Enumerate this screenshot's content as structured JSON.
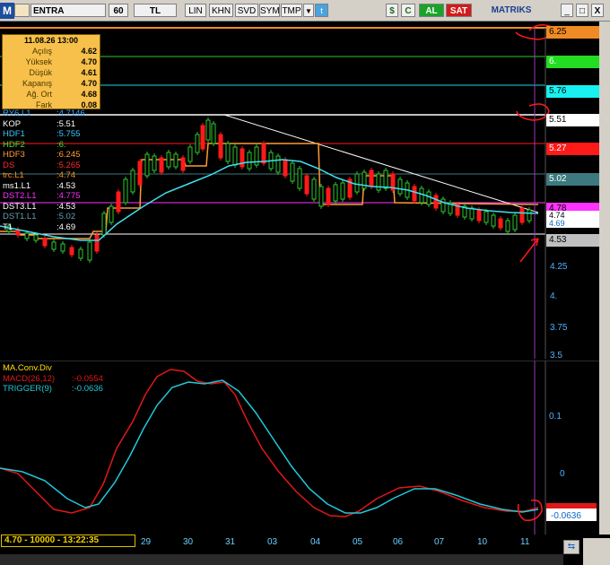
{
  "toolbar": {
    "logo": "M",
    "symbol": "ENTRA",
    "period": "60",
    "currency": "TL",
    "buttons": [
      "LIN",
      "KHN",
      "SVD",
      "SYM",
      "TMP"
    ],
    "dropdown_icon": "▼",
    "twitter_icon": "t",
    "dollar_icon": "$",
    "refresh_icon": "C",
    "buy": "AL",
    "sell": "SAT",
    "brand": "MATRIKS",
    "minimize": "_",
    "maximize": "□",
    "close": "X"
  },
  "info_box": {
    "date": "11.08.26 13:00",
    "rows": [
      {
        "label": "Açılış",
        "value": "4.62"
      },
      {
        "label": "Yüksek",
        "value": "4.70"
      },
      {
        "label": "Düşük",
        "value": "4.61"
      },
      {
        "label": "Kapanış",
        "value": "4.70"
      },
      {
        "label": "Ağ. Ort",
        "value": "4.68"
      },
      {
        "label": "Fark",
        "value": "0.08"
      }
    ]
  },
  "indicators": [
    {
      "name": "RY6.L1",
      "value": ":4.7146",
      "color": "#38a8ff"
    },
    {
      "name": "KOP",
      "value": ":5.51",
      "color": "#ffffff"
    },
    {
      "name": "HDF1",
      "value": ":5.755",
      "color": "#3bc8ff"
    },
    {
      "name": "HDF2",
      "value": ":6.",
      "color": "#39e639"
    },
    {
      "name": "HDF3",
      "value": ":6.245",
      "color": "#ff9b33"
    },
    {
      "name": "DS",
      "value": ":5.265",
      "color": "#ff2a2a"
    },
    {
      "name": "trc.L1",
      "value": ":4.74",
      "color": "#ff8a1a"
    },
    {
      "name": "ms1.L1",
      "value": ":4.53",
      "color": "#ffffff"
    },
    {
      "name": "DST2.L1",
      "value": ":4.775",
      "color": "#ff30ff"
    },
    {
      "name": "DST3.L1",
      "value": ":4.53",
      "color": "#ffffff"
    },
    {
      "name": "DST1.L1",
      "value": ":5.02",
      "color": "#5fa0b5"
    },
    {
      "name": "T1",
      "value": ":4.69",
      "color": "#ffffff"
    }
  ],
  "price_tags": [
    {
      "text": "6.25",
      "bg": "#f08a24",
      "fg": "#000000"
    },
    {
      "text": "6.",
      "bg": "#22dd22",
      "fg": "#ffffff"
    },
    {
      "text": "5.76",
      "bg": "#19f0f0",
      "fg": "#000000"
    },
    {
      "text": "5.51",
      "bg": "#ffffff",
      "fg": "#000000"
    },
    {
      "text": "5.27",
      "bg": "#ff1a1a",
      "fg": "#ffffff"
    },
    {
      "text": "5.02",
      "bg": "#3d7a80",
      "fg": "#ffffff"
    },
    {
      "text": "4.78",
      "bg": "#ff33ff",
      "fg": "#000000"
    },
    {
      "text": "4.74",
      "bg": "#ffffff",
      "fg": "#000000"
    },
    {
      "text": "4.69",
      "bg": "#ffffff",
      "fg": "#0a64c8"
    },
    {
      "text": "4.53",
      "bg": "#c0c0c0",
      "fg": "#000000"
    }
  ],
  "price_axis": [
    "4.25",
    "4.",
    "3.75",
    "3.5"
  ],
  "macd": {
    "title": "MA.Conv.Div",
    "macd_label": "MACD(26,12)",
    "macd_value": ":-0.0554",
    "trigger_label": "TRIGGER(9)",
    "trigger_value": ":-0.0636",
    "axis": [
      "0.1",
      "0"
    ],
    "tag": "-0.0636",
    "colors": {
      "macd": "#e01818",
      "trigger": "#20c8d8"
    }
  },
  "status": "4.70 - 10000 - 13:22:35",
  "date_labels": [
    "29",
    "30",
    "31",
    "03",
    "04",
    "05",
    "06",
    "07",
    "10",
    "11"
  ],
  "scroll_icon": "⇆"
}
